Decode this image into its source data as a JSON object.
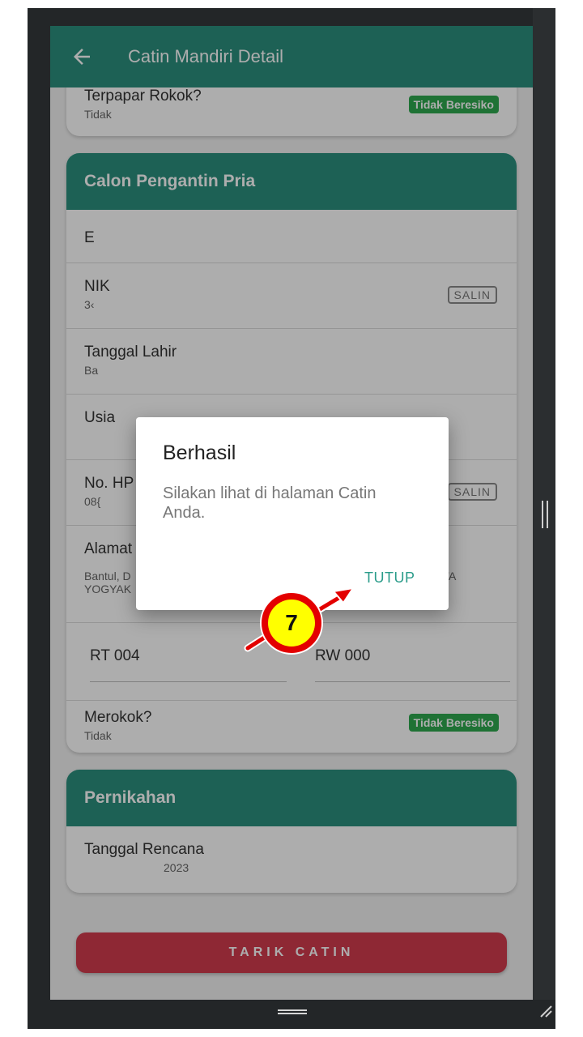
{
  "appbar": {
    "title": "Catin Mandiri Detail",
    "back_icon": "arrow-left-icon"
  },
  "top_card": {
    "label": "Terpapar Rokok?",
    "value": "Tidak",
    "badge": "Tidak Beresiko"
  },
  "groom_card": {
    "title": "Calon Pengantin Pria",
    "name_value": "E",
    "nik": {
      "label": "NIK",
      "value": "3‹",
      "copy_label": "SALIN"
    },
    "birth": {
      "label": "Tanggal Lahir",
      "value": "Ba"
    },
    "age": {
      "label": "Usia"
    },
    "phone": {
      "label": "No. HP",
      "value": "08{",
      "copy_label": "SALIN"
    },
    "address": {
      "label": "Alamat",
      "line1": "Bantul, D",
      "line1_tail": "EWA",
      "line2": "YOGYAK"
    },
    "rt": "RT 004",
    "rw": "RW 000",
    "smoking": {
      "label": "Merokok?",
      "value": "Tidak",
      "badge": "Tidak Beresiko"
    }
  },
  "marriage_card": {
    "title": "Pernikahan",
    "plan": {
      "label": "Tanggal Rencana",
      "value": "2023"
    }
  },
  "primary_button": "TARIK CATIN",
  "dialog": {
    "title": "Berhasil",
    "message": "Silakan lihat di halaman Catin Anda.",
    "button": "TUTUP"
  },
  "step_marker": {
    "number": "7"
  },
  "colors": {
    "primary": "#2b8f7e",
    "danger": "#d13b4d",
    "badge": "#2fa84f",
    "dialog_button": "#2b9c8a",
    "marker_fill": "#ffff00",
    "marker_ring": "#e30000"
  }
}
